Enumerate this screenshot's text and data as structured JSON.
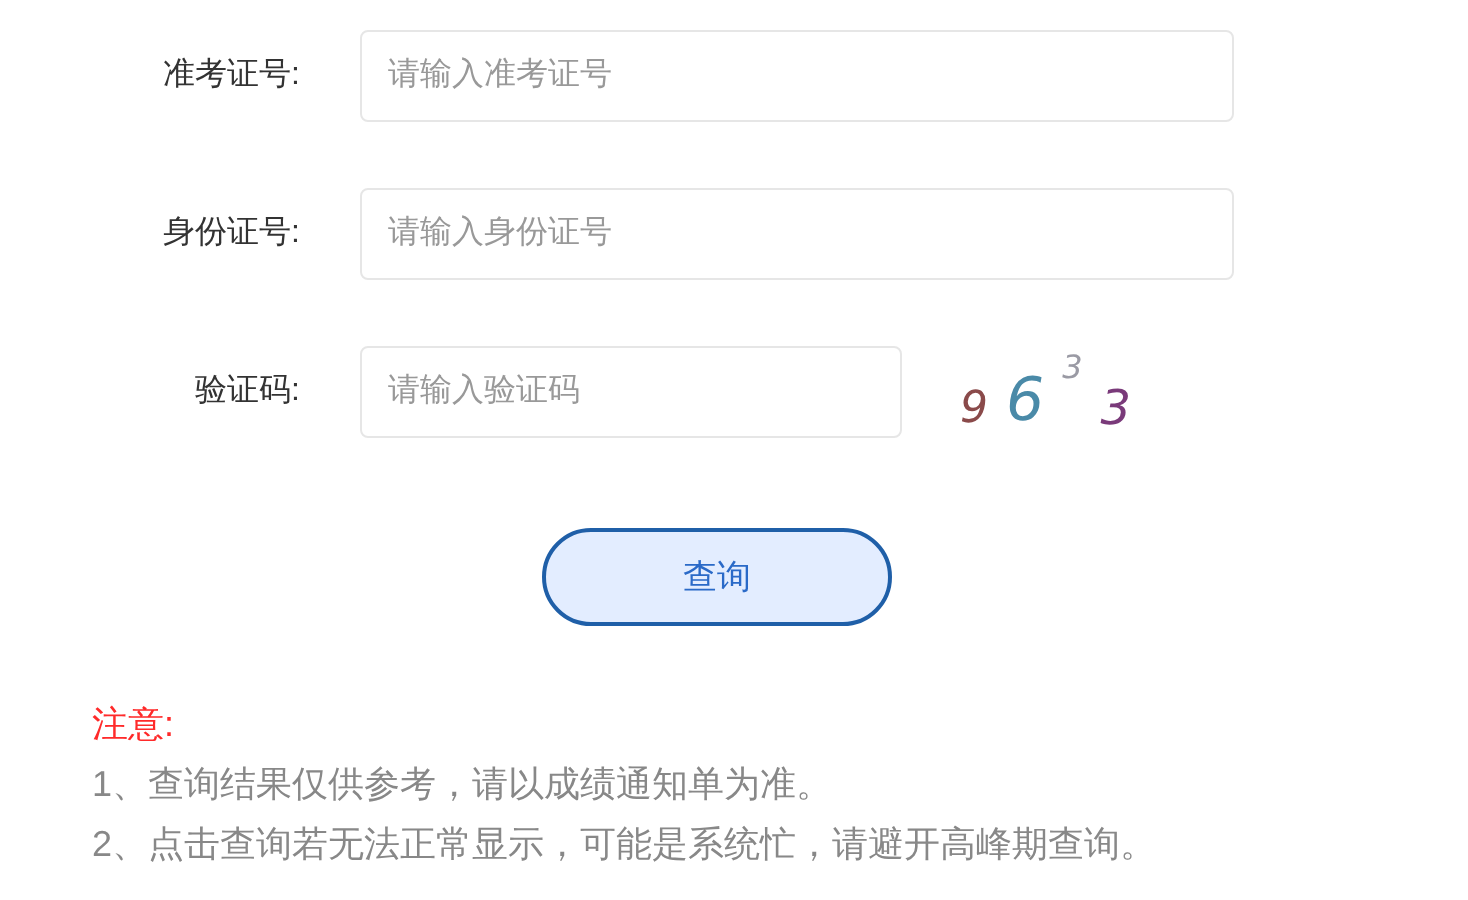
{
  "fields": [
    {
      "label": "准考证号:",
      "placeholder": "请输入准考证号"
    },
    {
      "label": "身份证号:",
      "placeholder": "请输入身份证号"
    },
    {
      "label": "验证码:",
      "placeholder": "请输入验证码",
      "kind": "captcha"
    }
  ],
  "captcha": [
    {
      "char": "9",
      "color": "#8a4a4a"
    },
    {
      "char": "6",
      "color": "#4a8aa8"
    },
    {
      "char": "3",
      "color": "#9a9aa4"
    },
    {
      "char": "3",
      "color": "#7a3a7a"
    }
  ],
  "button": "查询",
  "notice": {
    "title": "注意:",
    "lines": [
      "1、查询结果仅供参考，请以成绩通知单为准。",
      "2、点击查询若无法正常显示，可能是系统忙，请避开高峰期查询。"
    ]
  }
}
